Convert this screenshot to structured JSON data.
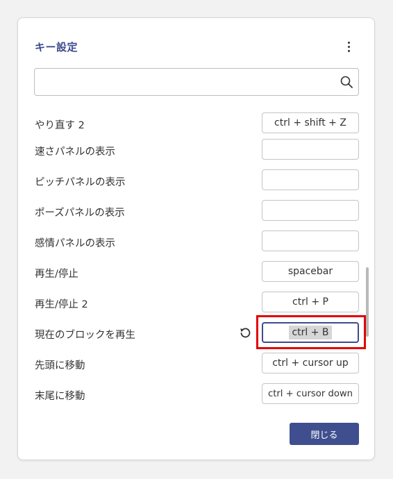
{
  "dialog": {
    "title": "キー設定",
    "search": {
      "value": "",
      "placeholder": ""
    },
    "close_label": "閉じる",
    "accent_color": "#3d4a8e"
  },
  "shortcuts": [
    {
      "label": "やり直す 2",
      "key": "ctrl + shift + Z"
    },
    {
      "label": "速さパネルの表示",
      "key": ""
    },
    {
      "label": "ピッチパネルの表示",
      "key": ""
    },
    {
      "label": "ポーズパネルの表示",
      "key": ""
    },
    {
      "label": "感情パネルの表示",
      "key": ""
    },
    {
      "label": "再生/停止",
      "key": "spacebar"
    },
    {
      "label": "再生/停止 2",
      "key": "ctrl + P"
    },
    {
      "label": "現在のブロックを再生",
      "key": "ctrl + B"
    },
    {
      "label": "先頭に移動",
      "key": "ctrl + cursor up"
    },
    {
      "label": "末尾に移動",
      "key": "ctrl + cursor down"
    }
  ],
  "icons": {
    "menu": "more-vert-icon",
    "search": "search-icon",
    "reset": "undo-icon"
  }
}
